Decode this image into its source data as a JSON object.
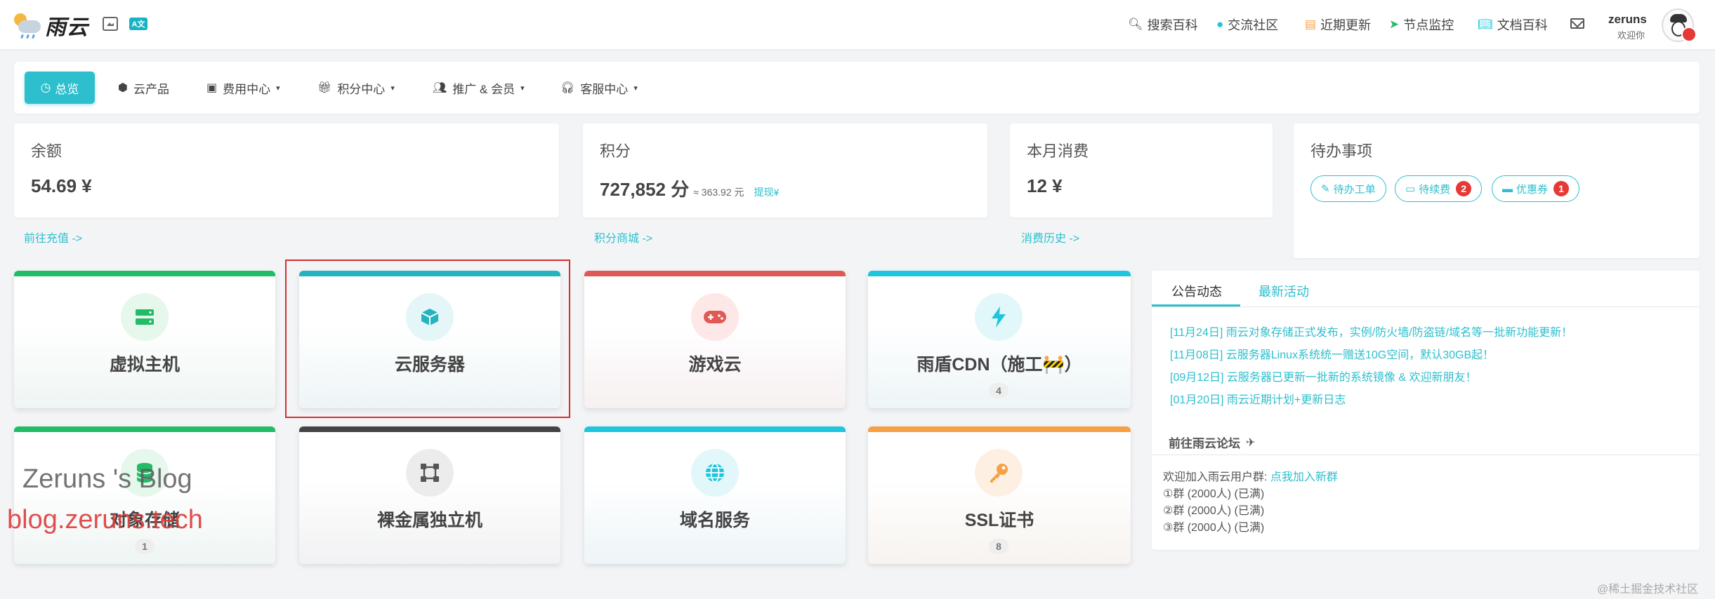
{
  "header": {
    "logo_text": "雨云",
    "nav": [
      {
        "label": "搜索百科",
        "icon": "search-icon"
      },
      {
        "label": "交流社区",
        "icon": "penguin-icon"
      },
      {
        "label": "近期更新",
        "icon": "newspaper-icon"
      },
      {
        "label": "节点监控",
        "icon": "send-icon"
      },
      {
        "label": "文档百科",
        "icon": "book-icon"
      }
    ],
    "user": {
      "name": "zeruns",
      "subtitle": "欢迎你"
    }
  },
  "subnav": {
    "active": {
      "label": "总览",
      "icon": "dashboard-icon"
    },
    "items": [
      {
        "label": "云产品",
        "icon": "cubes-icon"
      },
      {
        "label": "费用中心",
        "icon": "money-icon"
      },
      {
        "label": "积分中心",
        "icon": "gift-icon"
      },
      {
        "label": "推广 & 会员",
        "icon": "users-icon"
      },
      {
        "label": "客服中心",
        "icon": "headset-icon"
      }
    ]
  },
  "stats": {
    "balance": {
      "title": "余额",
      "value": "54.69 ¥",
      "link": "前往充值 ->"
    },
    "points": {
      "title": "积分",
      "value": "727,852 分",
      "approx": "≈ 363.92 元",
      "withdraw": "提现¥",
      "link": "积分商城 ->"
    },
    "monthly": {
      "title": "本月消费",
      "value": "12 ¥",
      "link": "消费历史 ->"
    }
  },
  "todo": {
    "title": "待办事项",
    "items": [
      {
        "label": "待办工单",
        "icon": "pencil-icon",
        "count": null
      },
      {
        "label": "待续费",
        "icon": "ticket-icon",
        "count": "2"
      },
      {
        "label": "优惠券",
        "icon": "coupon-icon",
        "count": "1"
      }
    ]
  },
  "products": [
    {
      "name": "虚拟主机",
      "count": null,
      "accent": "#22bb66",
      "icon_bg": "#e6f7ec",
      "icon_color": "#22bb66",
      "icon": "server-icon"
    },
    {
      "name": "云服务器",
      "count": null,
      "accent": "#25b3c0",
      "icon_bg": "#e4f6f8",
      "icon_color": "#25b3c0",
      "icon": "box-icon"
    },
    {
      "name": "游戏云",
      "count": null,
      "accent": "#e05a55",
      "icon_bg": "#fde8e7",
      "icon_color": "#e05a55",
      "icon": "gamepad-icon"
    },
    {
      "name": "雨盾CDN（施工🚧）",
      "count": "4",
      "accent": "#1ec5dc",
      "icon_bg": "#e2f7fa",
      "icon_color": "#1ec5dc",
      "icon": "bolt-icon"
    },
    {
      "name": "对象存储",
      "count": "1",
      "accent": "#22bb66",
      "icon_bg": "#e6f7ec",
      "icon_color": "#22bb66",
      "icon": "database-icon"
    },
    {
      "name": "裸金属独立机",
      "count": null,
      "accent": "#444444",
      "icon_bg": "#ececec",
      "icon_color": "#555555",
      "icon": "vector-square-icon"
    },
    {
      "name": "域名服务",
      "count": null,
      "accent": "#1ec5dc",
      "icon_bg": "#e2f7fa",
      "icon_color": "#1ec5dc",
      "icon": "globe-icon"
    },
    {
      "name": "SSL证书",
      "count": "8",
      "accent": "#f5a045",
      "icon_bg": "#fdf0e2",
      "icon_color": "#f5a045",
      "icon": "key-icon"
    }
  ],
  "announcements": {
    "tabs": [
      "公告动态",
      "最新活动"
    ],
    "items": [
      "[11月24日] 雨云对象存储正式发布，实例/防火墙/防盗链/域名等一批新功能更新！",
      "[11月08日] 云服务器Linux系统统一赠送10G空间，默认30GB起！",
      "[09月12日] 云服务器已更新一批新的系统镜像 & 欢迎新朋友！",
      "[01月20日] 雨云近期计划+更新日志"
    ],
    "forum": "前往雨云论坛",
    "group_intro": "欢迎加入雨云用户群:",
    "group_link": "点我加入新群",
    "groups": [
      "①群 (2000人) (已满)",
      "②群 (2000人) (已满)",
      "③群 (2000人) (已满)"
    ]
  },
  "watermarks": {
    "blog_title": "Zeruns 's Blog",
    "blog_url": "blog.zeruns.tech",
    "source": "@稀土掘金技术社区"
  },
  "colors": {
    "accent": "#2dbfcd",
    "highlight": "#d32f2f",
    "badge": "#e53935"
  }
}
